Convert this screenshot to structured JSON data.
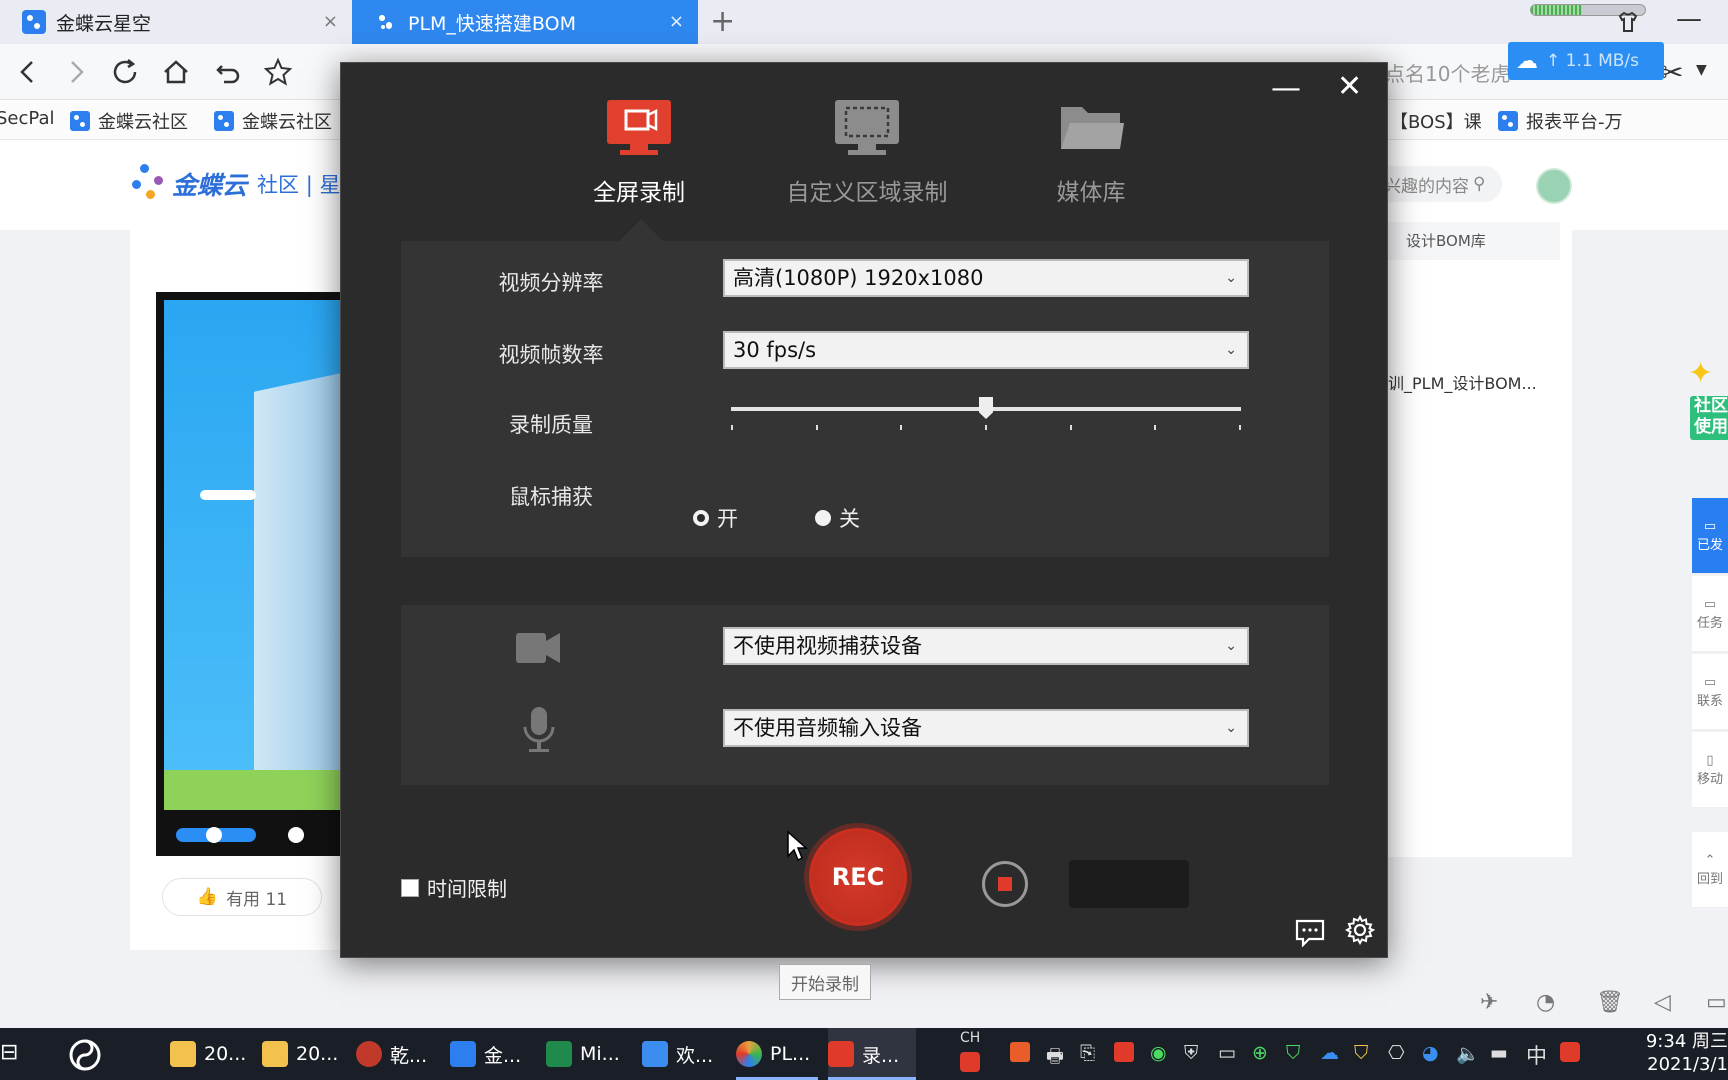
{
  "browser": {
    "tabs": [
      {
        "title": "金蝶云星空",
        "close": "×"
      },
      {
        "title": "PLM_快速搭建BOM",
        "close": "×"
      }
    ],
    "new_tab": "+",
    "nav_right_text": "点名10个老虎",
    "speed": "↑ 1.1 MB/s",
    "bookmarks": [
      "SecPal",
      "金蝶云社区",
      "金蝶云社区",
      "【BOS】课",
      "报表平台-万"
    ]
  },
  "page": {
    "logo_text": "金蝶云",
    "logo_sub": "社区 | 星",
    "search_placeholder": "兴趣的内容",
    "crumb": "设计BOM库",
    "right_item": "训_PLM_设计BOM...",
    "useful_label": "有用 11",
    "float_badge": "社区使用",
    "rail": [
      "已发",
      "任务",
      "联系",
      "移动",
      "回到"
    ]
  },
  "recorder": {
    "minimize": "—",
    "close": "✕",
    "tabs": [
      {
        "label": "全屏录制",
        "icon": "monitor-record-icon",
        "active": true
      },
      {
        "label": "自定义区域录制",
        "icon": "region-select-icon",
        "active": false
      },
      {
        "label": "媒体库",
        "icon": "folder-icon",
        "active": false
      }
    ],
    "settings": {
      "resolution_label": "视频分辨率",
      "resolution_value": "高清(1080P)   1920x1080",
      "fps_label": "视频帧数率",
      "fps_value": "30 fps/s",
      "quality_label": "录制质量",
      "quality_level": 0.5,
      "cursor_label": "鼠标捕获",
      "cursor_on": "开",
      "cursor_off": "关",
      "cursor_selected": "开"
    },
    "devices": {
      "video_icon": "camera-icon",
      "video_value": "不使用视频捕获设备",
      "audio_icon": "microphone-icon",
      "audio_value": "不使用音频输入设备"
    },
    "time_limit_label": "时间限制",
    "rec_label": "REC",
    "tooltip": "开始录制",
    "accent": "#d63a2a"
  },
  "taskbar": {
    "apps": [
      {
        "label": "20...",
        "color": "#f2c14e"
      },
      {
        "label": "20...",
        "color": "#f2c14e"
      },
      {
        "label": "乾...",
        "color": "#c0392b"
      },
      {
        "label": "金...",
        "color": "#2d7ff0"
      },
      {
        "label": "Mi...",
        "color": "#1f8a4c"
      },
      {
        "label": "欢...",
        "color": "#3b8ef0"
      },
      {
        "label": "PL...",
        "color": "#e8a33d"
      },
      {
        "label": "录...",
        "color": "#e03a2a"
      }
    ],
    "ime": "CH",
    "lang": "中",
    "time": "9:34 周三",
    "date": "2021/3/1"
  }
}
